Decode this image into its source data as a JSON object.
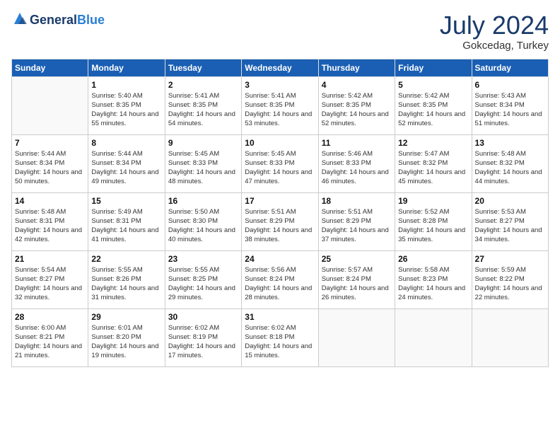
{
  "logo": {
    "general": "General",
    "blue": "Blue"
  },
  "title": "July 2024",
  "location": "Gokcedag, Turkey",
  "days_of_week": [
    "Sunday",
    "Monday",
    "Tuesday",
    "Wednesday",
    "Thursday",
    "Friday",
    "Saturday"
  ],
  "weeks": [
    [
      {
        "day": "",
        "sunrise": "",
        "sunset": "",
        "daylight": "",
        "empty": true
      },
      {
        "day": "1",
        "sunrise": "Sunrise: 5:40 AM",
        "sunset": "Sunset: 8:35 PM",
        "daylight": "Daylight: 14 hours and 55 minutes."
      },
      {
        "day": "2",
        "sunrise": "Sunrise: 5:41 AM",
        "sunset": "Sunset: 8:35 PM",
        "daylight": "Daylight: 14 hours and 54 minutes."
      },
      {
        "day": "3",
        "sunrise": "Sunrise: 5:41 AM",
        "sunset": "Sunset: 8:35 PM",
        "daylight": "Daylight: 14 hours and 53 minutes."
      },
      {
        "day": "4",
        "sunrise": "Sunrise: 5:42 AM",
        "sunset": "Sunset: 8:35 PM",
        "daylight": "Daylight: 14 hours and 52 minutes."
      },
      {
        "day": "5",
        "sunrise": "Sunrise: 5:42 AM",
        "sunset": "Sunset: 8:35 PM",
        "daylight": "Daylight: 14 hours and 52 minutes."
      },
      {
        "day": "6",
        "sunrise": "Sunrise: 5:43 AM",
        "sunset": "Sunset: 8:34 PM",
        "daylight": "Daylight: 14 hours and 51 minutes."
      }
    ],
    [
      {
        "day": "7",
        "sunrise": "Sunrise: 5:44 AM",
        "sunset": "Sunset: 8:34 PM",
        "daylight": "Daylight: 14 hours and 50 minutes."
      },
      {
        "day": "8",
        "sunrise": "Sunrise: 5:44 AM",
        "sunset": "Sunset: 8:34 PM",
        "daylight": "Daylight: 14 hours and 49 minutes."
      },
      {
        "day": "9",
        "sunrise": "Sunrise: 5:45 AM",
        "sunset": "Sunset: 8:33 PM",
        "daylight": "Daylight: 14 hours and 48 minutes."
      },
      {
        "day": "10",
        "sunrise": "Sunrise: 5:45 AM",
        "sunset": "Sunset: 8:33 PM",
        "daylight": "Daylight: 14 hours and 47 minutes."
      },
      {
        "day": "11",
        "sunrise": "Sunrise: 5:46 AM",
        "sunset": "Sunset: 8:33 PM",
        "daylight": "Daylight: 14 hours and 46 minutes."
      },
      {
        "day": "12",
        "sunrise": "Sunrise: 5:47 AM",
        "sunset": "Sunset: 8:32 PM",
        "daylight": "Daylight: 14 hours and 45 minutes."
      },
      {
        "day": "13",
        "sunrise": "Sunrise: 5:48 AM",
        "sunset": "Sunset: 8:32 PM",
        "daylight": "Daylight: 14 hours and 44 minutes."
      }
    ],
    [
      {
        "day": "14",
        "sunrise": "Sunrise: 5:48 AM",
        "sunset": "Sunset: 8:31 PM",
        "daylight": "Daylight: 14 hours and 42 minutes."
      },
      {
        "day": "15",
        "sunrise": "Sunrise: 5:49 AM",
        "sunset": "Sunset: 8:31 PM",
        "daylight": "Daylight: 14 hours and 41 minutes."
      },
      {
        "day": "16",
        "sunrise": "Sunrise: 5:50 AM",
        "sunset": "Sunset: 8:30 PM",
        "daylight": "Daylight: 14 hours and 40 minutes."
      },
      {
        "day": "17",
        "sunrise": "Sunrise: 5:51 AM",
        "sunset": "Sunset: 8:29 PM",
        "daylight": "Daylight: 14 hours and 38 minutes."
      },
      {
        "day": "18",
        "sunrise": "Sunrise: 5:51 AM",
        "sunset": "Sunset: 8:29 PM",
        "daylight": "Daylight: 14 hours and 37 minutes."
      },
      {
        "day": "19",
        "sunrise": "Sunrise: 5:52 AM",
        "sunset": "Sunset: 8:28 PM",
        "daylight": "Daylight: 14 hours and 35 minutes."
      },
      {
        "day": "20",
        "sunrise": "Sunrise: 5:53 AM",
        "sunset": "Sunset: 8:27 PM",
        "daylight": "Daylight: 14 hours and 34 minutes."
      }
    ],
    [
      {
        "day": "21",
        "sunrise": "Sunrise: 5:54 AM",
        "sunset": "Sunset: 8:27 PM",
        "daylight": "Daylight: 14 hours and 32 minutes."
      },
      {
        "day": "22",
        "sunrise": "Sunrise: 5:55 AM",
        "sunset": "Sunset: 8:26 PM",
        "daylight": "Daylight: 14 hours and 31 minutes."
      },
      {
        "day": "23",
        "sunrise": "Sunrise: 5:55 AM",
        "sunset": "Sunset: 8:25 PM",
        "daylight": "Daylight: 14 hours and 29 minutes."
      },
      {
        "day": "24",
        "sunrise": "Sunrise: 5:56 AM",
        "sunset": "Sunset: 8:24 PM",
        "daylight": "Daylight: 14 hours and 28 minutes."
      },
      {
        "day": "25",
        "sunrise": "Sunrise: 5:57 AM",
        "sunset": "Sunset: 8:24 PM",
        "daylight": "Daylight: 14 hours and 26 minutes."
      },
      {
        "day": "26",
        "sunrise": "Sunrise: 5:58 AM",
        "sunset": "Sunset: 8:23 PM",
        "daylight": "Daylight: 14 hours and 24 minutes."
      },
      {
        "day": "27",
        "sunrise": "Sunrise: 5:59 AM",
        "sunset": "Sunset: 8:22 PM",
        "daylight": "Daylight: 14 hours and 22 minutes."
      }
    ],
    [
      {
        "day": "28",
        "sunrise": "Sunrise: 6:00 AM",
        "sunset": "Sunset: 8:21 PM",
        "daylight": "Daylight: 14 hours and 21 minutes."
      },
      {
        "day": "29",
        "sunrise": "Sunrise: 6:01 AM",
        "sunset": "Sunset: 8:20 PM",
        "daylight": "Daylight: 14 hours and 19 minutes."
      },
      {
        "day": "30",
        "sunrise": "Sunrise: 6:02 AM",
        "sunset": "Sunset: 8:19 PM",
        "daylight": "Daylight: 14 hours and 17 minutes."
      },
      {
        "day": "31",
        "sunrise": "Sunrise: 6:02 AM",
        "sunset": "Sunset: 8:18 PM",
        "daylight": "Daylight: 14 hours and 15 minutes."
      },
      {
        "day": "",
        "sunrise": "",
        "sunset": "",
        "daylight": "",
        "empty": true
      },
      {
        "day": "",
        "sunrise": "",
        "sunset": "",
        "daylight": "",
        "empty": true
      },
      {
        "day": "",
        "sunrise": "",
        "sunset": "",
        "daylight": "",
        "empty": true
      }
    ]
  ]
}
